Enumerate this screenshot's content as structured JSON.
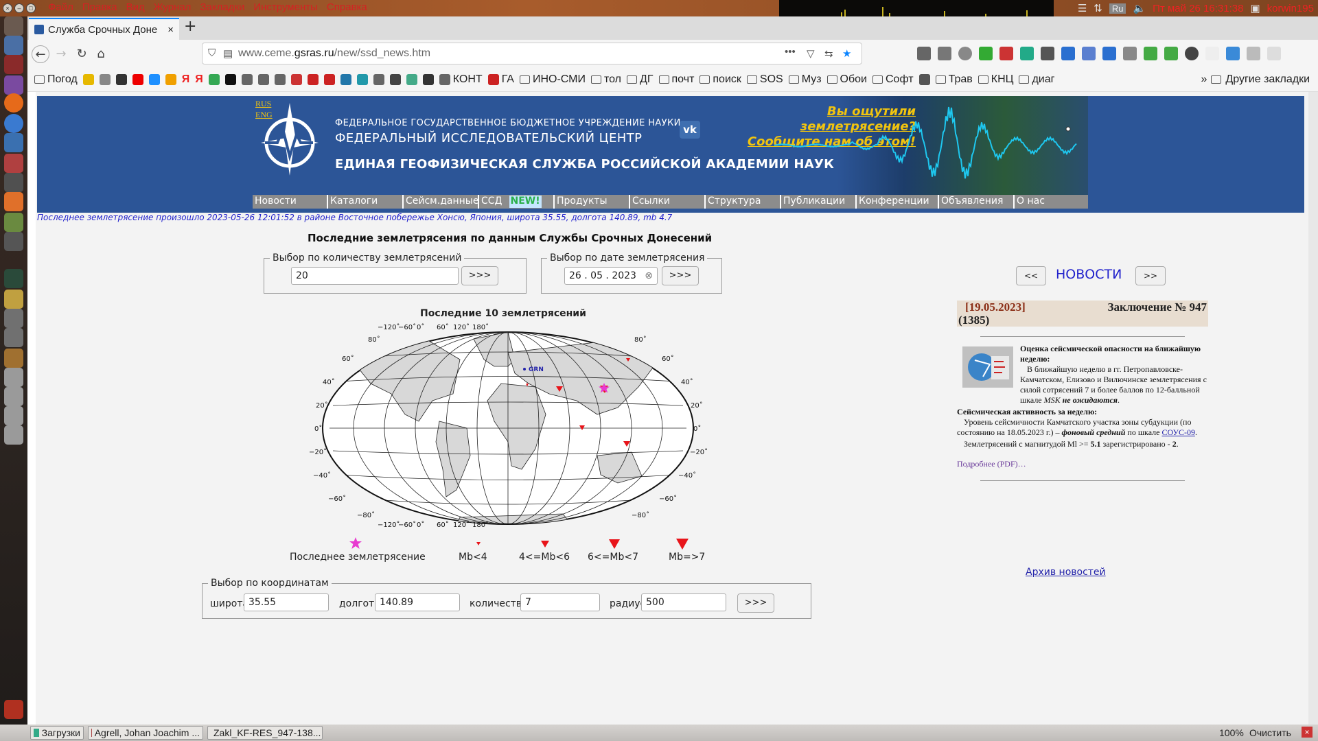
{
  "topbar": {
    "menu": [
      "Файл",
      "Правка",
      "Вид",
      "Журнал",
      "Закладки",
      "Инструменты",
      "Справка"
    ],
    "clock": "Пт май 26 16:31:38",
    "user": "korwin195",
    "lang": "Ru"
  },
  "tab": {
    "title": "Служба Срочных Доне",
    "close": "×",
    "new": "+"
  },
  "url": {
    "prefix": "www.ceme.",
    "domain": "gsras.ru",
    "path": "/new/ssd_news.htm"
  },
  "bookmarks": [
    {
      "type": "folder",
      "label": "Погод"
    },
    {
      "type": "icon",
      "color": "#e6b800"
    },
    {
      "type": "icon",
      "color": "#888"
    },
    {
      "type": "icon",
      "color": "#333"
    },
    {
      "type": "icon",
      "color": "#e00"
    },
    {
      "type": "icon",
      "color": "#1e90ff"
    },
    {
      "type": "icon",
      "color": "#f0a000"
    },
    {
      "type": "text",
      "label": "Я",
      "color": "#e22"
    },
    {
      "type": "text",
      "label": "Я",
      "color": "#e22"
    },
    {
      "type": "icon",
      "color": "#34a853"
    },
    {
      "type": "icon",
      "color": "#111"
    },
    {
      "type": "icon",
      "color": "#666"
    },
    {
      "type": "icon",
      "color": "#666"
    },
    {
      "type": "icon",
      "color": "#666"
    },
    {
      "type": "icon",
      "color": "#c33"
    },
    {
      "type": "icon",
      "color": "#c22"
    },
    {
      "type": "icon",
      "color": "#c22"
    },
    {
      "type": "icon",
      "color": "#27a"
    },
    {
      "type": "icon",
      "color": "#29a"
    },
    {
      "type": "icon",
      "color": "#666"
    },
    {
      "type": "icon",
      "color": "#444"
    },
    {
      "type": "icon",
      "color": "#4a8"
    },
    {
      "type": "icon",
      "color": "#333"
    },
    {
      "type": "icon",
      "color": "#666",
      "label": "КОНТ"
    },
    {
      "type": "icon",
      "color": "#c22",
      "label": "ГА"
    },
    {
      "type": "folder",
      "label": "ИНО-СМИ"
    },
    {
      "type": "folder",
      "label": "тол"
    },
    {
      "type": "folder",
      "label": "ДГ"
    },
    {
      "type": "folder",
      "label": "почт"
    },
    {
      "type": "folder",
      "label": "поиск"
    },
    {
      "type": "folder",
      "label": "SOS"
    },
    {
      "type": "folder",
      "label": "Муз"
    },
    {
      "type": "folder",
      "label": "Обои"
    },
    {
      "type": "folder",
      "label": "Софт"
    },
    {
      "type": "icon",
      "color": "#555"
    },
    {
      "type": "folder",
      "label": "Трав"
    },
    {
      "type": "folder",
      "label": "КНЦ"
    },
    {
      "type": "folder",
      "label": "диаг"
    }
  ],
  "bookmarks_more": "»",
  "bookmarks_other": "Другие закладки",
  "banner": {
    "lang_ru": "RUS",
    "lang_en": "ENG",
    "line1": "ФЕДЕРАЛЬНОЕ ГОСУДАРСТВЕННОЕ БЮДЖЕТНОЕ УЧРЕЖДЕНИЕ НАУКИ",
    "line2": "ФЕДЕРАЛЬНЫЙ ИССЛЕДОВАТЕЛЬСКИЙ ЦЕНТР",
    "line3": "ЕДИНАЯ ГЕОФИЗИЧЕСКАЯ СЛУЖБА РОССИЙСКОЙ АКАДЕМИИ НАУК",
    "felt1": "Вы ощутили землетрясение?",
    "felt2": "Сообщите нам об этом!",
    "vk": "vk"
  },
  "nav": [
    "Новости",
    "Каталоги",
    "Сейсм.данные",
    "ССД",
    "NEW!",
    "Продукты",
    "Ссылки",
    "Структура",
    "Публикации",
    "Конференции",
    "Объявления",
    "О нас"
  ],
  "last_quake": "Последнее землетрясение произошло 2023-05-26 12:01:52 в районе Восточное побережье Хонсю, Япония, широта 35.55, долгота 140.89, mb 4.7",
  "ssd_title": "Последние землетрясения по данным Службы Срочных Донесений",
  "by_count": {
    "legend": "Выбор по количеству землетрясений",
    "value": "20",
    "button": ">>>"
  },
  "by_date": {
    "legend": "Выбор по дате землетрясения",
    "value": "26 . 05 . 2023",
    "clear": "⊗",
    "button": ">>>"
  },
  "map": {
    "title": "Последние 10 землетрясений",
    "lon_labels": [
      "−120˚",
      "−60˚",
      "0˚",
      "60˚",
      "120˚",
      "180˚"
    ],
    "lat_labels": [
      "80˚",
      "60˚",
      "40˚",
      "20˚",
      "0˚",
      "−20˚",
      "−40˚",
      "−60˚",
      "−80˚"
    ],
    "city": "GRN"
  },
  "map_legend": {
    "last": "Последнее землетрясение",
    "c1": "Mb<4",
    "c2": "4<=Mb<6",
    "c3": "6<=Mb<7",
    "c4": "Mb=>7"
  },
  "by_coords": {
    "legend": "Выбор по координатам",
    "lat_label": "широта",
    "lat": "35.55",
    "lon_label": "долгота",
    "lon": "140.89",
    "count_label": "количество",
    "count": "7",
    "radius_label": "радиус",
    "radius": "500",
    "button": ">>>"
  },
  "news": {
    "prev": "<<",
    "title": "НОВОСТИ",
    "next": ">>",
    "date": "[19.05.2023]",
    "headline": "Заключение № 947",
    "num": "(1385)",
    "h1": "Оценка сейсмической опасности на ближайшую неделю:",
    "p1a": "В ближайшую неделю в гг. Петропавловске-Камчатском, Елизово и Вилючинске землетрясения с силой сотрясений 7 и более баллов по 12-балльной шкале",
    "p1b": "MSK",
    "p1c": "не ожидаются",
    "h2": "Сейсмическая активность за неделю:",
    "p2a": "Уровень сейсмичности Камчатского участка зоны субдукции (по состоянию на 18.05.2023 г.) –",
    "p2b": "фоновый средний",
    "p2c": "по шкале",
    "p2d": "СОУС-09",
    "p3a": "Землетрясений с магнитудой Ml >=",
    "p3b": "5.1",
    "p3c": "зарегистрировано -",
    "p3d": "2",
    "more": "Подробнее (PDF)…",
    "archive": "Архив новостей"
  },
  "taskbar": {
    "items": [
      "Загрузки",
      "Agrell, Johan Joachim ...",
      "Zakl_KF-RES_947-138..."
    ],
    "zoom": "100%",
    "clear": "Очистить"
  }
}
